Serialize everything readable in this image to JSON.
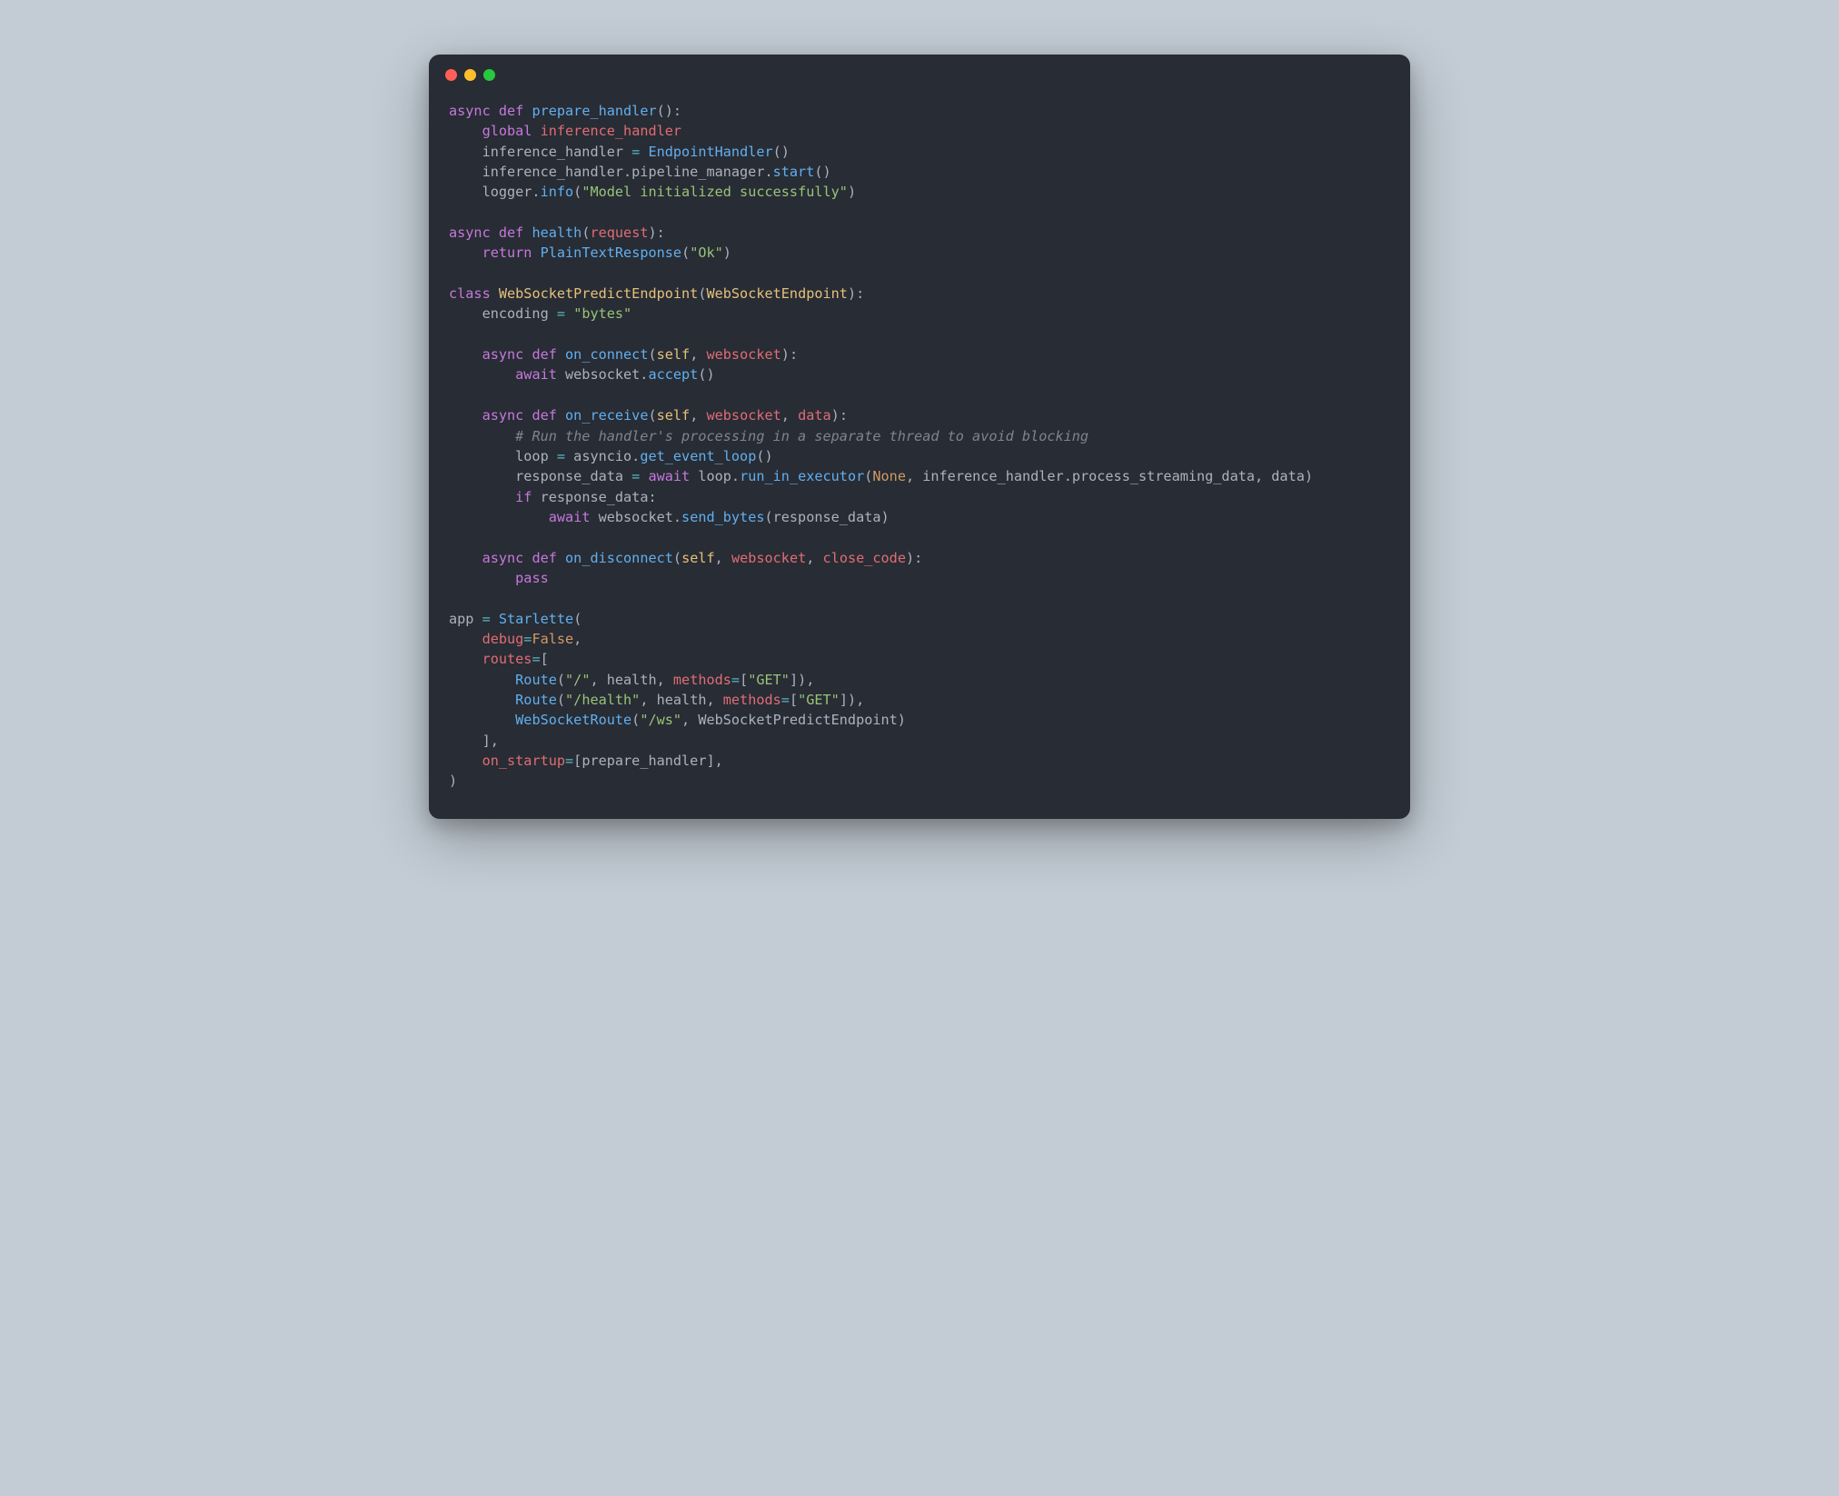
{
  "window": {
    "traffic_lights": [
      "red",
      "yellow",
      "green"
    ]
  },
  "code": {
    "language": "python",
    "theme": "one-dark",
    "tokens": [
      [
        {
          "c": "kw",
          "t": "async def"
        },
        {
          "c": "plain",
          "t": " "
        },
        {
          "c": "fn",
          "t": "prepare_handler"
        },
        {
          "c": "plain",
          "t": "():"
        }
      ],
      [
        {
          "c": "plain",
          "t": "    "
        },
        {
          "c": "kw",
          "t": "global"
        },
        {
          "c": "plain",
          "t": " "
        },
        {
          "c": "var",
          "t": "inference_handler"
        }
      ],
      [
        {
          "c": "plain",
          "t": "    inference_handler "
        },
        {
          "c": "op",
          "t": "="
        },
        {
          "c": "plain",
          "t": " "
        },
        {
          "c": "fn",
          "t": "EndpointHandler"
        },
        {
          "c": "plain",
          "t": "()"
        }
      ],
      [
        {
          "c": "plain",
          "t": "    inference_handler.pipeline_manager."
        },
        {
          "c": "fn",
          "t": "start"
        },
        {
          "c": "plain",
          "t": "()"
        }
      ],
      [
        {
          "c": "plain",
          "t": "    logger."
        },
        {
          "c": "fn",
          "t": "info"
        },
        {
          "c": "plain",
          "t": "("
        },
        {
          "c": "str",
          "t": "\"Model initialized successfully\""
        },
        {
          "c": "plain",
          "t": ")"
        }
      ],
      [],
      [
        {
          "c": "kw",
          "t": "async def"
        },
        {
          "c": "plain",
          "t": " "
        },
        {
          "c": "fn",
          "t": "health"
        },
        {
          "c": "plain",
          "t": "("
        },
        {
          "c": "param",
          "t": "request"
        },
        {
          "c": "plain",
          "t": "):"
        }
      ],
      [
        {
          "c": "plain",
          "t": "    "
        },
        {
          "c": "kw",
          "t": "return"
        },
        {
          "c": "plain",
          "t": " "
        },
        {
          "c": "fn",
          "t": "PlainTextResponse"
        },
        {
          "c": "plain",
          "t": "("
        },
        {
          "c": "str",
          "t": "\"Ok\""
        },
        {
          "c": "plain",
          "t": ")"
        }
      ],
      [],
      [
        {
          "c": "kw",
          "t": "class"
        },
        {
          "c": "plain",
          "t": " "
        },
        {
          "c": "cls",
          "t": "WebSocketPredictEndpoint"
        },
        {
          "c": "plain",
          "t": "("
        },
        {
          "c": "cls",
          "t": "WebSocketEndpoint"
        },
        {
          "c": "plain",
          "t": "):"
        }
      ],
      [
        {
          "c": "plain",
          "t": "    encoding "
        },
        {
          "c": "op",
          "t": "="
        },
        {
          "c": "plain",
          "t": " "
        },
        {
          "c": "str",
          "t": "\"bytes\""
        }
      ],
      [],
      [
        {
          "c": "plain",
          "t": "    "
        },
        {
          "c": "kw",
          "t": "async def"
        },
        {
          "c": "plain",
          "t": " "
        },
        {
          "c": "fn",
          "t": "on_connect"
        },
        {
          "c": "plain",
          "t": "("
        },
        {
          "c": "self",
          "t": "self"
        },
        {
          "c": "plain",
          "t": ", "
        },
        {
          "c": "param",
          "t": "websocket"
        },
        {
          "c": "plain",
          "t": "):"
        }
      ],
      [
        {
          "c": "plain",
          "t": "        "
        },
        {
          "c": "kw",
          "t": "await"
        },
        {
          "c": "plain",
          "t": " websocket."
        },
        {
          "c": "fn",
          "t": "accept"
        },
        {
          "c": "plain",
          "t": "()"
        }
      ],
      [],
      [
        {
          "c": "plain",
          "t": "    "
        },
        {
          "c": "kw",
          "t": "async def"
        },
        {
          "c": "plain",
          "t": " "
        },
        {
          "c": "fn",
          "t": "on_receive"
        },
        {
          "c": "plain",
          "t": "("
        },
        {
          "c": "self",
          "t": "self"
        },
        {
          "c": "plain",
          "t": ", "
        },
        {
          "c": "param",
          "t": "websocket"
        },
        {
          "c": "plain",
          "t": ", "
        },
        {
          "c": "param",
          "t": "data"
        },
        {
          "c": "plain",
          "t": "):"
        }
      ],
      [
        {
          "c": "plain",
          "t": "        "
        },
        {
          "c": "cmt",
          "t": "# Run the handler's processing in a separate thread to avoid blocking"
        }
      ],
      [
        {
          "c": "plain",
          "t": "        loop "
        },
        {
          "c": "op",
          "t": "="
        },
        {
          "c": "plain",
          "t": " asyncio."
        },
        {
          "c": "fn",
          "t": "get_event_loop"
        },
        {
          "c": "plain",
          "t": "()"
        }
      ],
      [
        {
          "c": "plain",
          "t": "        response_data "
        },
        {
          "c": "op",
          "t": "="
        },
        {
          "c": "plain",
          "t": " "
        },
        {
          "c": "kw",
          "t": "await"
        },
        {
          "c": "plain",
          "t": " loop."
        },
        {
          "c": "fn",
          "t": "run_in_executor"
        },
        {
          "c": "plain",
          "t": "("
        },
        {
          "c": "bool",
          "t": "None"
        },
        {
          "c": "plain",
          "t": ", inference_handler.process_streaming_data, data)"
        }
      ],
      [
        {
          "c": "plain",
          "t": "        "
        },
        {
          "c": "kw",
          "t": "if"
        },
        {
          "c": "plain",
          "t": " response_data:"
        }
      ],
      [
        {
          "c": "plain",
          "t": "            "
        },
        {
          "c": "kw",
          "t": "await"
        },
        {
          "c": "plain",
          "t": " websocket."
        },
        {
          "c": "fn",
          "t": "send_bytes"
        },
        {
          "c": "plain",
          "t": "(response_data)"
        }
      ],
      [],
      [
        {
          "c": "plain",
          "t": "    "
        },
        {
          "c": "kw",
          "t": "async def"
        },
        {
          "c": "plain",
          "t": " "
        },
        {
          "c": "fn",
          "t": "on_disconnect"
        },
        {
          "c": "plain",
          "t": "("
        },
        {
          "c": "self",
          "t": "self"
        },
        {
          "c": "plain",
          "t": ", "
        },
        {
          "c": "param",
          "t": "websocket"
        },
        {
          "c": "plain",
          "t": ", "
        },
        {
          "c": "param",
          "t": "close_code"
        },
        {
          "c": "plain",
          "t": "):"
        }
      ],
      [
        {
          "c": "plain",
          "t": "        "
        },
        {
          "c": "kw",
          "t": "pass"
        }
      ],
      [],
      [
        {
          "c": "plain",
          "t": "app "
        },
        {
          "c": "op",
          "t": "="
        },
        {
          "c": "plain",
          "t": " "
        },
        {
          "c": "fn",
          "t": "Starlette"
        },
        {
          "c": "plain",
          "t": "("
        }
      ],
      [
        {
          "c": "plain",
          "t": "    "
        },
        {
          "c": "param",
          "t": "debug"
        },
        {
          "c": "op",
          "t": "="
        },
        {
          "c": "bool",
          "t": "False"
        },
        {
          "c": "plain",
          "t": ","
        }
      ],
      [
        {
          "c": "plain",
          "t": "    "
        },
        {
          "c": "param",
          "t": "routes"
        },
        {
          "c": "op",
          "t": "="
        },
        {
          "c": "plain",
          "t": "["
        }
      ],
      [
        {
          "c": "plain",
          "t": "        "
        },
        {
          "c": "fn",
          "t": "Route"
        },
        {
          "c": "plain",
          "t": "("
        },
        {
          "c": "str",
          "t": "\"/\""
        },
        {
          "c": "plain",
          "t": ", health, "
        },
        {
          "c": "param",
          "t": "methods"
        },
        {
          "c": "op",
          "t": "="
        },
        {
          "c": "plain",
          "t": "["
        },
        {
          "c": "str",
          "t": "\"GET\""
        },
        {
          "c": "plain",
          "t": "]),"
        }
      ],
      [
        {
          "c": "plain",
          "t": "        "
        },
        {
          "c": "fn",
          "t": "Route"
        },
        {
          "c": "plain",
          "t": "("
        },
        {
          "c": "str",
          "t": "\"/health\""
        },
        {
          "c": "plain",
          "t": ", health, "
        },
        {
          "c": "param",
          "t": "methods"
        },
        {
          "c": "op",
          "t": "="
        },
        {
          "c": "plain",
          "t": "["
        },
        {
          "c": "str",
          "t": "\"GET\""
        },
        {
          "c": "plain",
          "t": "]),"
        }
      ],
      [
        {
          "c": "plain",
          "t": "        "
        },
        {
          "c": "fn",
          "t": "WebSocketRoute"
        },
        {
          "c": "plain",
          "t": "("
        },
        {
          "c": "str",
          "t": "\"/ws\""
        },
        {
          "c": "plain",
          "t": ", WebSocketPredictEndpoint)"
        }
      ],
      [
        {
          "c": "plain",
          "t": "    ],"
        }
      ],
      [
        {
          "c": "plain",
          "t": "    "
        },
        {
          "c": "param",
          "t": "on_startup"
        },
        {
          "c": "op",
          "t": "="
        },
        {
          "c": "plain",
          "t": "[prepare_handler],"
        }
      ],
      [
        {
          "c": "plain",
          "t": ")"
        }
      ]
    ]
  }
}
